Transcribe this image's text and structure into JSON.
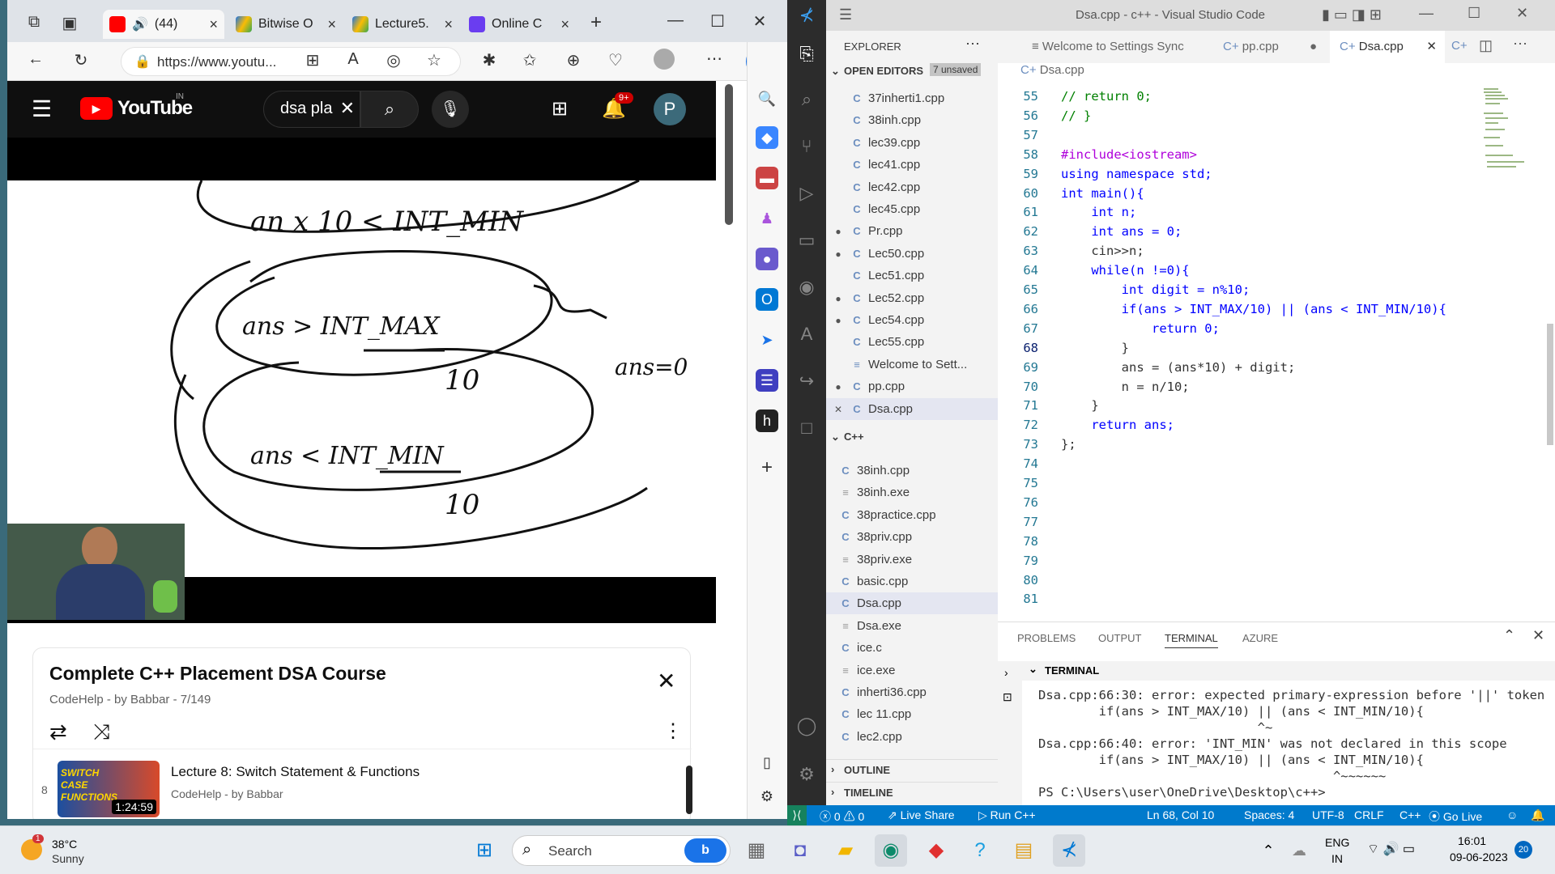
{
  "browser": {
    "tabs": [
      {
        "label": "(44)",
        "x": "×"
      },
      {
        "label": "Bitwise O",
        "x": "×"
      },
      {
        "label": "Lecture5.",
        "x": "×"
      },
      {
        "label": "Online C",
        "x": "×"
      }
    ],
    "new_tab": "+",
    "url": "https://www.youtu...",
    "youtube": {
      "logo": "YouTube",
      "region": "IN",
      "search_value": "dsa pla",
      "notif_count": "9+",
      "avatar": "P",
      "board_lines": [
        "an x 10 < INT_MIN",
        "ans > INT_MAX",
        "10",
        "ans=0",
        "ans < INT_MIN",
        "10"
      ],
      "playlist": {
        "title": "Complete C++ Placement DSA Course",
        "subtitle": "CodeHelp - by Babbar - 7/149",
        "item_index": "8",
        "item_title": "Lecture 8: Switch Statement & Functions",
        "item_channel": "CodeHelp - by Babbar",
        "item_duration": "1:24:59",
        "thumb_text": "SWITCH CASE FUNCTIONS"
      }
    }
  },
  "vscode": {
    "title": "Dsa.cpp - c++ - Visual Studio Code",
    "explorer_title": "EXPLORER",
    "open_editors": "OPEN EDITORS",
    "unsaved": "7 unsaved",
    "open_files": [
      {
        "name": "37inherti1.cpp",
        "dot": false
      },
      {
        "name": "38inh.cpp",
        "dot": false
      },
      {
        "name": "lec39.cpp",
        "dot": false
      },
      {
        "name": "lec41.cpp",
        "dot": false
      },
      {
        "name": "lec42.cpp",
        "dot": false
      },
      {
        "name": "lec45.cpp",
        "dot": false
      },
      {
        "name": "Pr.cpp",
        "dot": true
      },
      {
        "name": "Lec50.cpp",
        "dot": true
      },
      {
        "name": "Lec51.cpp",
        "dot": false
      },
      {
        "name": "Lec52.cpp",
        "dot": true
      },
      {
        "name": "Lec54.cpp",
        "dot": true
      },
      {
        "name": "Lec55.cpp",
        "dot": false
      },
      {
        "name": "Welcome to Sett...",
        "dot": false
      },
      {
        "name": "pp.cpp",
        "dot": true
      },
      {
        "name": "Dsa.cpp",
        "dot": false
      }
    ],
    "folder": "C++",
    "folder_files": [
      "38inh.cpp",
      "38inh.exe",
      "38practice.cpp",
      "38priv.cpp",
      "38priv.exe",
      "basic.cpp",
      "Dsa.cpp",
      "Dsa.exe",
      "ice.c",
      "ice.exe",
      "inherti36.cpp",
      "lec 11.cpp",
      "lec2.cpp"
    ],
    "outline": "OUTLINE",
    "timeline": "TIMELINE",
    "editor_tabs": [
      "Welcome to Settings Sync",
      "pp.cpp",
      "Dsa.cpp"
    ],
    "breadcrumb": "Dsa.cpp",
    "lines": [
      {
        "n": "55",
        "t": "// return 0;"
      },
      {
        "n": "56",
        "t": "// }"
      },
      {
        "n": "57",
        "t": ""
      },
      {
        "n": "58",
        "t": "#include<iostream>"
      },
      {
        "n": "59",
        "t": "using namespace std;"
      },
      {
        "n": "60",
        "t": "int main(){"
      },
      {
        "n": "61",
        "t": "    int n;"
      },
      {
        "n": "62",
        "t": "    int ans = 0;"
      },
      {
        "n": "63",
        "t": "    cin>>n;"
      },
      {
        "n": "64",
        "t": "    while(n !=0){"
      },
      {
        "n": "65",
        "t": "        int digit = n%10;"
      },
      {
        "n": "66",
        "t": "        if(ans > INT_MAX/10) || (ans < INT_MIN/10){"
      },
      {
        "n": "67",
        "t": "            return 0;"
      },
      {
        "n": "68",
        "t": "        }"
      },
      {
        "n": "69",
        "t": "        ans = (ans*10) + digit;"
      },
      {
        "n": "70",
        "t": "        n = n/10;"
      },
      {
        "n": "71",
        "t": "    }"
      },
      {
        "n": "72",
        "t": "    return ans;"
      },
      {
        "n": "73",
        "t": "};"
      },
      {
        "n": "74",
        "t": ""
      },
      {
        "n": "75",
        "t": ""
      },
      {
        "n": "76",
        "t": ""
      },
      {
        "n": "77",
        "t": ""
      },
      {
        "n": "78",
        "t": ""
      },
      {
        "n": "79",
        "t": ""
      },
      {
        "n": "80",
        "t": ""
      },
      {
        "n": "81",
        "t": ""
      }
    ],
    "panel_tabs": [
      "PROBLEMS",
      "OUTPUT",
      "TERMINAL",
      "AZURE"
    ],
    "terminal_header": "TERMINAL",
    "terminal": "Dsa.cpp:66:30: error: expected primary-expression before '||' token\n        if(ans > INT_MAX/10) || (ans < INT_MIN/10){\n                             ^~\nDsa.cpp:66:40: error: 'INT_MIN' was not declared in this scope\n        if(ans > INT_MAX/10) || (ans < INT_MIN/10){\n                                       ^~~~~~~\nPS C:\\Users\\user\\OneDrive\\Desktop\\c++> ",
    "status": {
      "errors": "0",
      "warnings": "0",
      "live_share": "Live Share",
      "run": "Run C++",
      "position": "Ln 68, Col 10",
      "spaces": "Spaces: 4",
      "encoding": "UTF-8",
      "eol": "CRLF",
      "lang": "C++",
      "go_live": "Go Live"
    }
  },
  "taskbar": {
    "weather_temp": "38°C",
    "weather_desc": "Sunny",
    "weather_badge": "1",
    "search": "Search",
    "lang": "ENG",
    "lang2": "IN",
    "time": "16:01",
    "date": "09-06-2023",
    "notif": "20"
  }
}
